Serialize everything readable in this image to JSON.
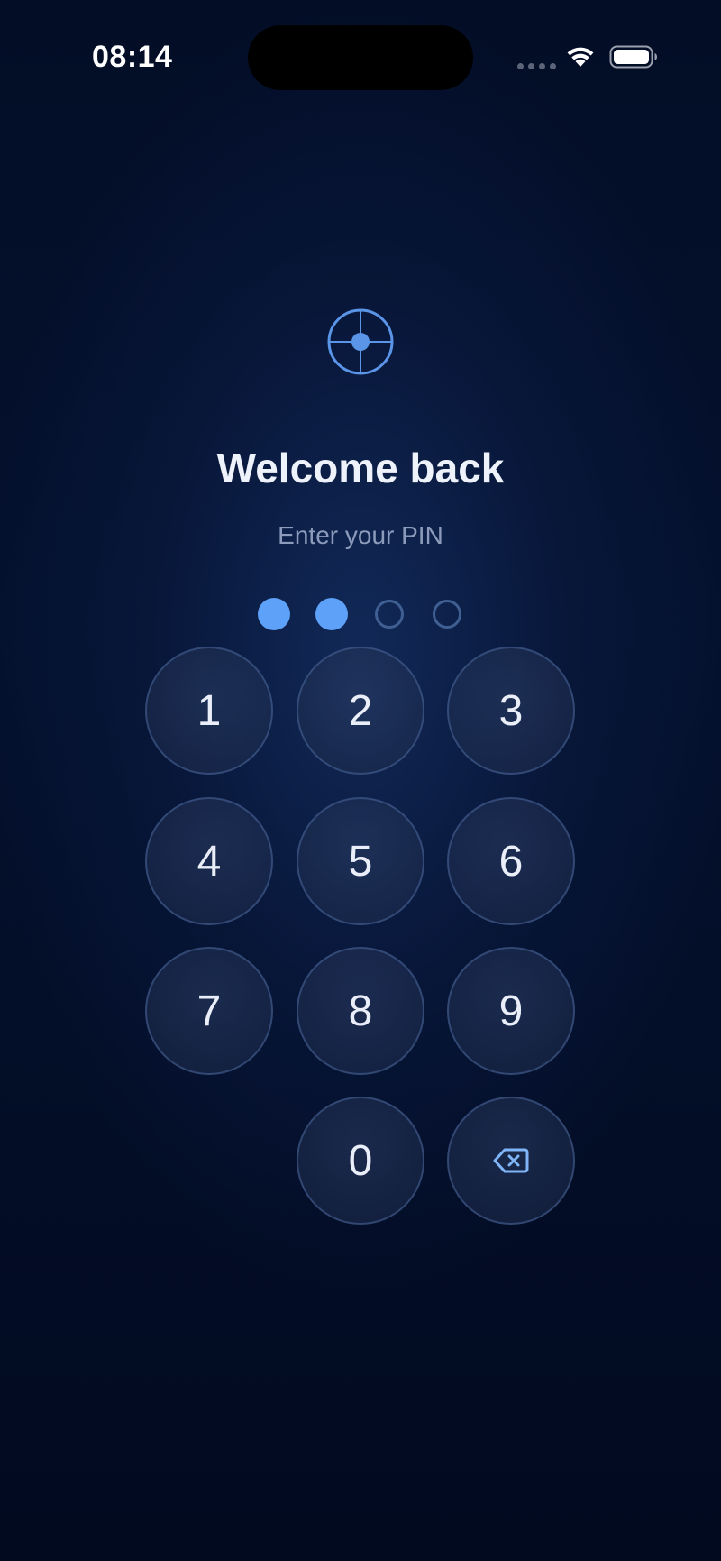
{
  "status_bar": {
    "time": "08:14",
    "icons": [
      "signal-icon",
      "wifi-icon",
      "battery-icon"
    ]
  },
  "header": {
    "logo_icon": "crosshair-icon",
    "title": "Welcome back",
    "subtitle": "Enter your PIN"
  },
  "pin": {
    "length": 4,
    "entered": 2
  },
  "keypad": {
    "keys": [
      "1",
      "2",
      "3",
      "4",
      "5",
      "6",
      "7",
      "8",
      "9",
      "0"
    ],
    "delete_icon": "backspace-icon"
  },
  "colors": {
    "accent": "#5ea1f8",
    "background": "#030d26",
    "key_border": "#4a689c",
    "subtitle": "#8c9bbb"
  }
}
